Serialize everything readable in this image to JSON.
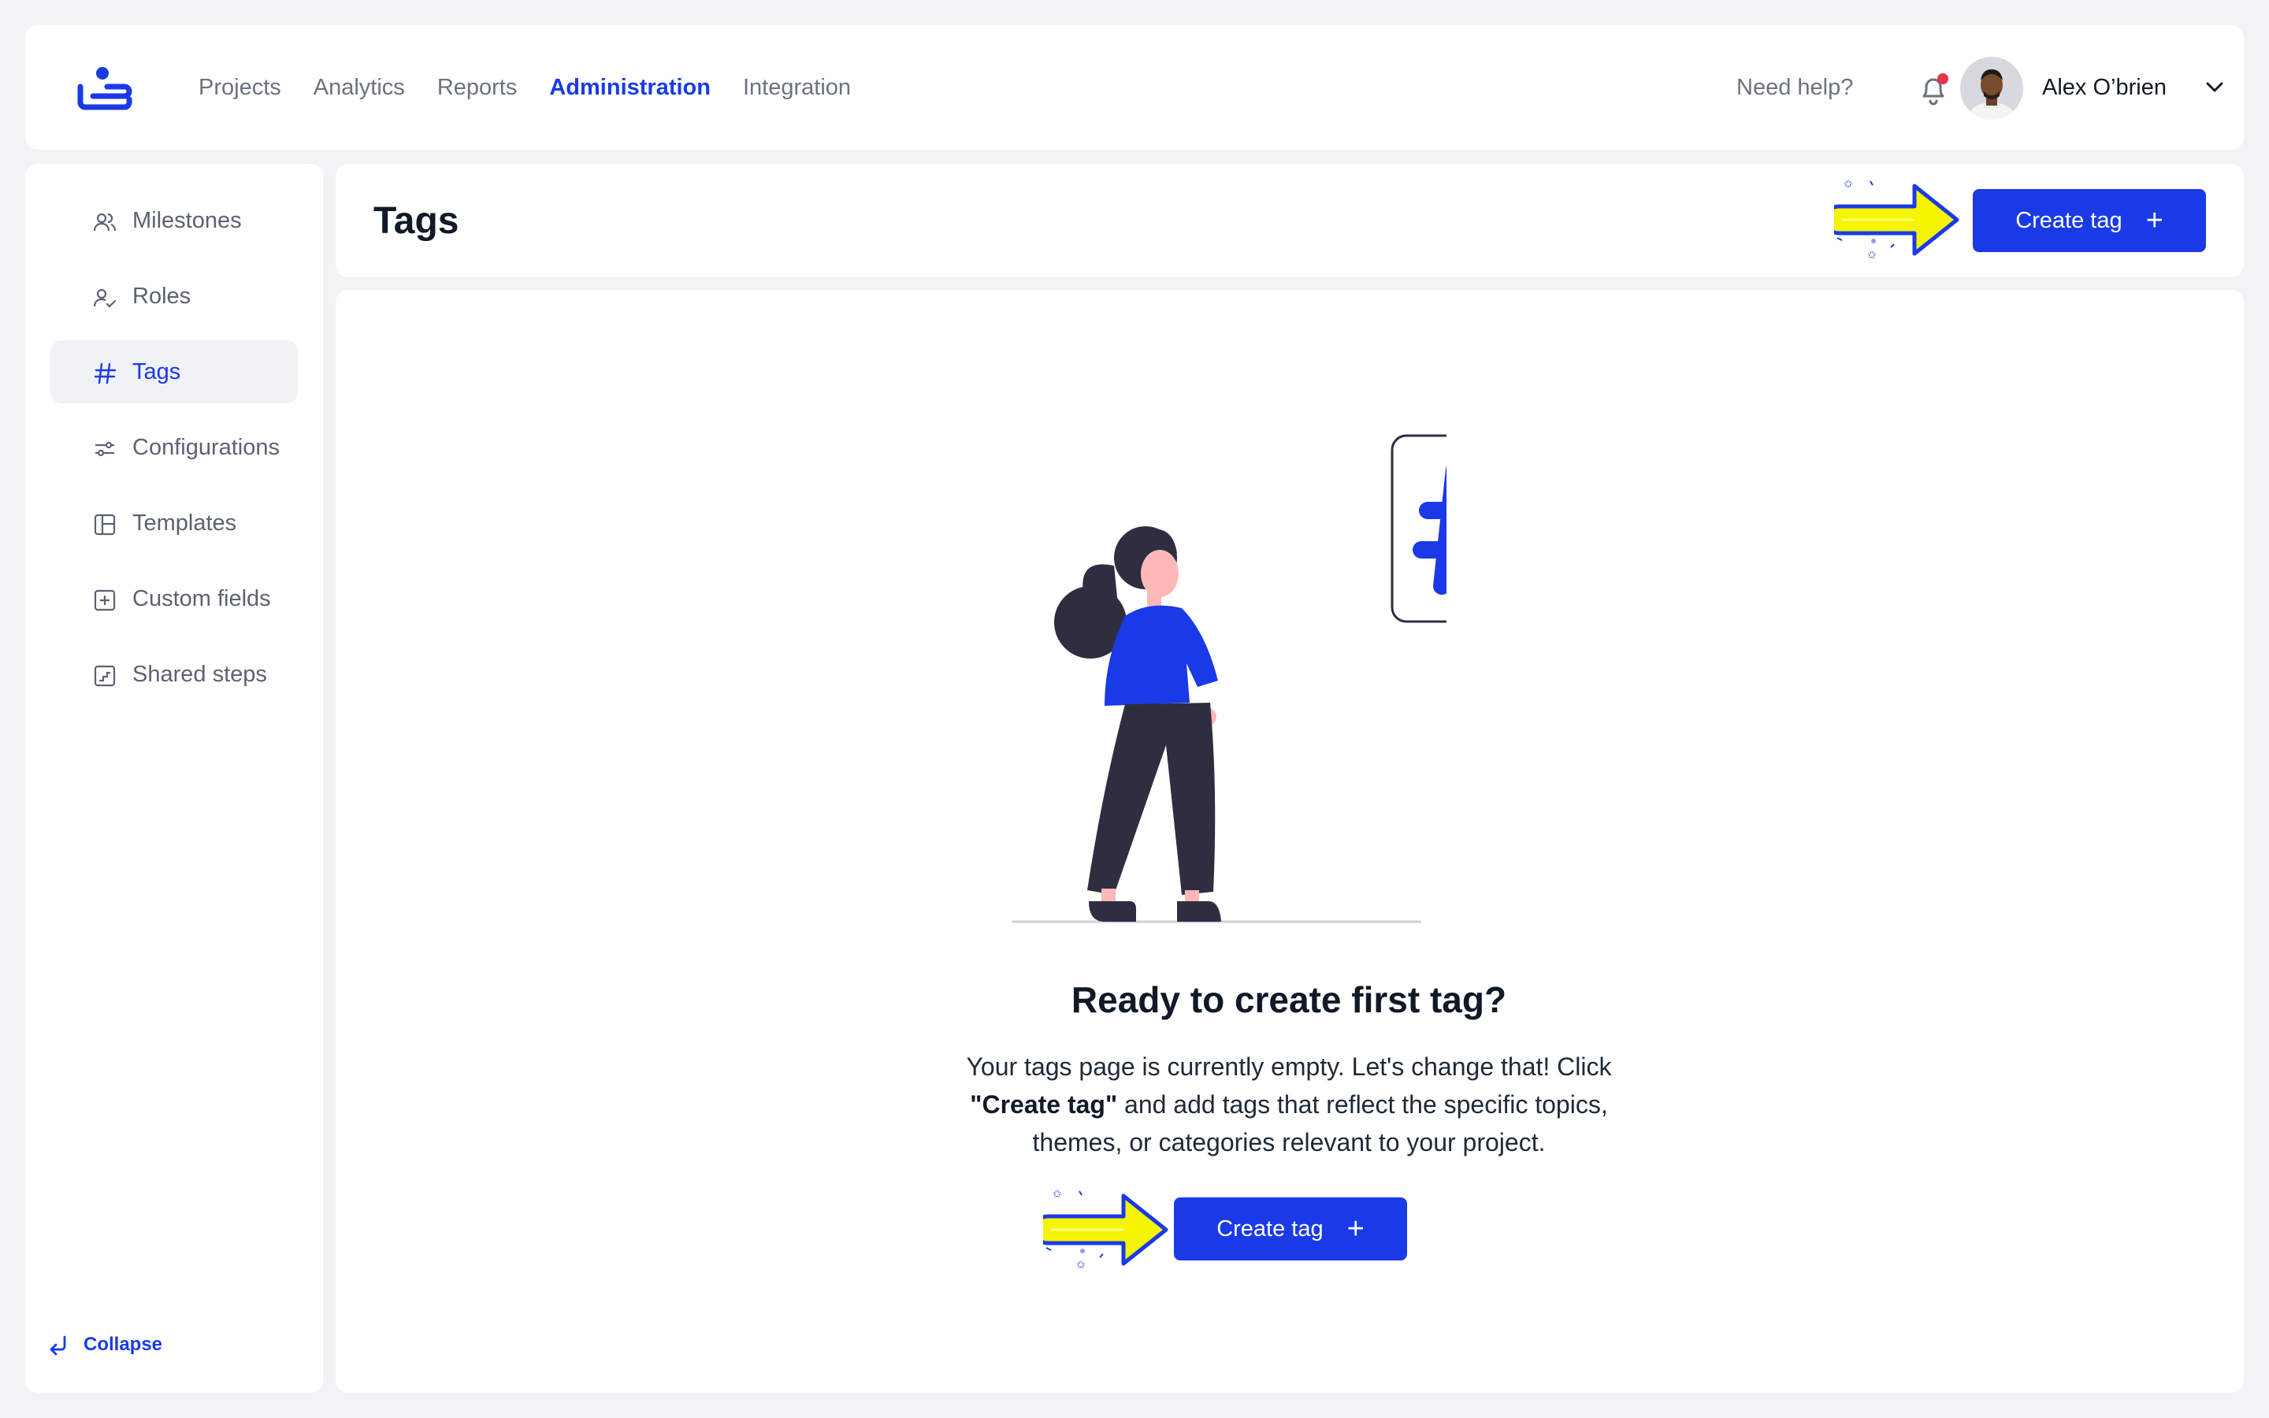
{
  "nav": {
    "items": [
      {
        "label": "Projects",
        "active": false
      },
      {
        "label": "Analytics",
        "active": false
      },
      {
        "label": "Reports",
        "active": false
      },
      {
        "label": "Administration",
        "active": true
      },
      {
        "label": "Integration",
        "active": false
      }
    ],
    "help_label": "Need help?",
    "user_name": "Alex O’brien",
    "notification_badge_color": "#e5344c"
  },
  "sidebar": {
    "items": [
      {
        "label": "Milestones",
        "icon": "users-icon",
        "active": false
      },
      {
        "label": "Roles",
        "icon": "user-check-icon",
        "active": false
      },
      {
        "label": "Tags",
        "icon": "hashtag-icon",
        "active": true
      },
      {
        "label": "Configurations",
        "icon": "sliders-icon",
        "active": false
      },
      {
        "label": "Templates",
        "icon": "layout-icon",
        "active": false
      },
      {
        "label": "Custom fields",
        "icon": "plus-square-icon",
        "active": false
      },
      {
        "label": "Shared steps",
        "icon": "steps-icon",
        "active": false
      }
    ],
    "collapse_label": "Collapse"
  },
  "page": {
    "title": "Tags",
    "create_button_label": "Create tag"
  },
  "empty_state": {
    "title": "Ready to create first tag?",
    "desc_line1": "Your tags page is currently empty. Let's change that! Click",
    "desc_bold": "\"Create tag\"",
    "desc_line2": " and add tags that reflect the specific topics,",
    "desc_line3": "themes, or categories relevant to your project.",
    "button_label": "Create tag"
  },
  "colors": {
    "accent": "#1a3ae8",
    "highlight_arrow": "#f5f500",
    "figure_shirt": "#1a3ae8",
    "figure_dark": "#2f2e41"
  }
}
